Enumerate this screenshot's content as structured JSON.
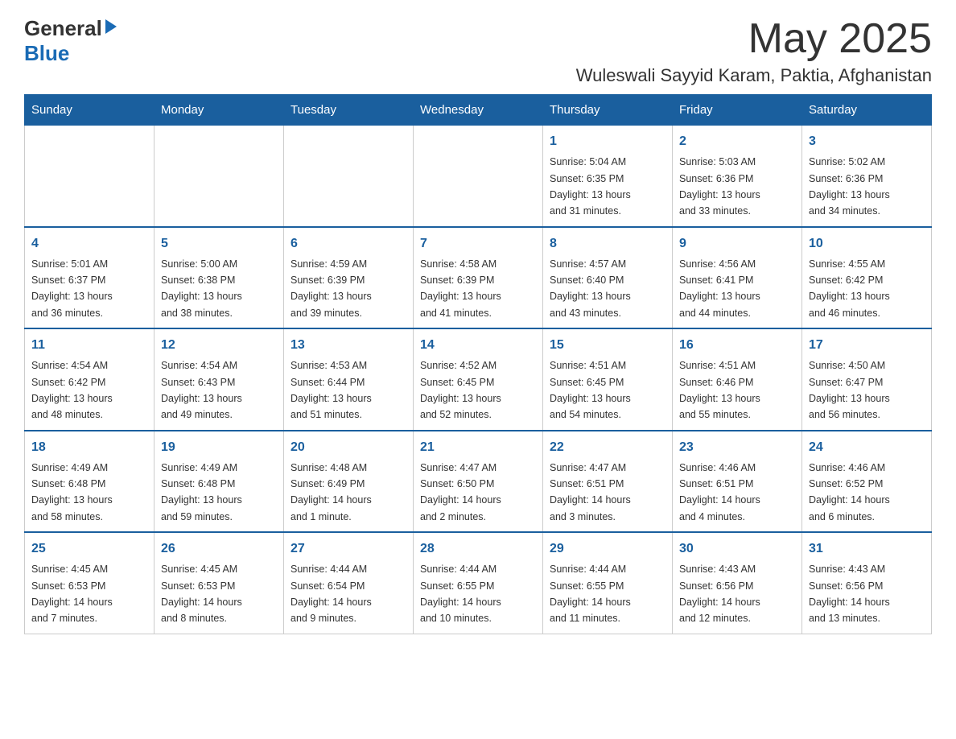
{
  "header": {
    "logo_general": "General",
    "logo_blue": "Blue",
    "month": "May 2025",
    "location": "Wuleswali Sayyid Karam, Paktia, Afghanistan"
  },
  "days_of_week": [
    "Sunday",
    "Monday",
    "Tuesday",
    "Wednesday",
    "Thursday",
    "Friday",
    "Saturday"
  ],
  "weeks": [
    [
      {
        "day": "",
        "info": ""
      },
      {
        "day": "",
        "info": ""
      },
      {
        "day": "",
        "info": ""
      },
      {
        "day": "",
        "info": ""
      },
      {
        "day": "1",
        "info": "Sunrise: 5:04 AM\nSunset: 6:35 PM\nDaylight: 13 hours\nand 31 minutes."
      },
      {
        "day": "2",
        "info": "Sunrise: 5:03 AM\nSunset: 6:36 PM\nDaylight: 13 hours\nand 33 minutes."
      },
      {
        "day": "3",
        "info": "Sunrise: 5:02 AM\nSunset: 6:36 PM\nDaylight: 13 hours\nand 34 minutes."
      }
    ],
    [
      {
        "day": "4",
        "info": "Sunrise: 5:01 AM\nSunset: 6:37 PM\nDaylight: 13 hours\nand 36 minutes."
      },
      {
        "day": "5",
        "info": "Sunrise: 5:00 AM\nSunset: 6:38 PM\nDaylight: 13 hours\nand 38 minutes."
      },
      {
        "day": "6",
        "info": "Sunrise: 4:59 AM\nSunset: 6:39 PM\nDaylight: 13 hours\nand 39 minutes."
      },
      {
        "day": "7",
        "info": "Sunrise: 4:58 AM\nSunset: 6:39 PM\nDaylight: 13 hours\nand 41 minutes."
      },
      {
        "day": "8",
        "info": "Sunrise: 4:57 AM\nSunset: 6:40 PM\nDaylight: 13 hours\nand 43 minutes."
      },
      {
        "day": "9",
        "info": "Sunrise: 4:56 AM\nSunset: 6:41 PM\nDaylight: 13 hours\nand 44 minutes."
      },
      {
        "day": "10",
        "info": "Sunrise: 4:55 AM\nSunset: 6:42 PM\nDaylight: 13 hours\nand 46 minutes."
      }
    ],
    [
      {
        "day": "11",
        "info": "Sunrise: 4:54 AM\nSunset: 6:42 PM\nDaylight: 13 hours\nand 48 minutes."
      },
      {
        "day": "12",
        "info": "Sunrise: 4:54 AM\nSunset: 6:43 PM\nDaylight: 13 hours\nand 49 minutes."
      },
      {
        "day": "13",
        "info": "Sunrise: 4:53 AM\nSunset: 6:44 PM\nDaylight: 13 hours\nand 51 minutes."
      },
      {
        "day": "14",
        "info": "Sunrise: 4:52 AM\nSunset: 6:45 PM\nDaylight: 13 hours\nand 52 minutes."
      },
      {
        "day": "15",
        "info": "Sunrise: 4:51 AM\nSunset: 6:45 PM\nDaylight: 13 hours\nand 54 minutes."
      },
      {
        "day": "16",
        "info": "Sunrise: 4:51 AM\nSunset: 6:46 PM\nDaylight: 13 hours\nand 55 minutes."
      },
      {
        "day": "17",
        "info": "Sunrise: 4:50 AM\nSunset: 6:47 PM\nDaylight: 13 hours\nand 56 minutes."
      }
    ],
    [
      {
        "day": "18",
        "info": "Sunrise: 4:49 AM\nSunset: 6:48 PM\nDaylight: 13 hours\nand 58 minutes."
      },
      {
        "day": "19",
        "info": "Sunrise: 4:49 AM\nSunset: 6:48 PM\nDaylight: 13 hours\nand 59 minutes."
      },
      {
        "day": "20",
        "info": "Sunrise: 4:48 AM\nSunset: 6:49 PM\nDaylight: 14 hours\nand 1 minute."
      },
      {
        "day": "21",
        "info": "Sunrise: 4:47 AM\nSunset: 6:50 PM\nDaylight: 14 hours\nand 2 minutes."
      },
      {
        "day": "22",
        "info": "Sunrise: 4:47 AM\nSunset: 6:51 PM\nDaylight: 14 hours\nand 3 minutes."
      },
      {
        "day": "23",
        "info": "Sunrise: 4:46 AM\nSunset: 6:51 PM\nDaylight: 14 hours\nand 4 minutes."
      },
      {
        "day": "24",
        "info": "Sunrise: 4:46 AM\nSunset: 6:52 PM\nDaylight: 14 hours\nand 6 minutes."
      }
    ],
    [
      {
        "day": "25",
        "info": "Sunrise: 4:45 AM\nSunset: 6:53 PM\nDaylight: 14 hours\nand 7 minutes."
      },
      {
        "day": "26",
        "info": "Sunrise: 4:45 AM\nSunset: 6:53 PM\nDaylight: 14 hours\nand 8 minutes."
      },
      {
        "day": "27",
        "info": "Sunrise: 4:44 AM\nSunset: 6:54 PM\nDaylight: 14 hours\nand 9 minutes."
      },
      {
        "day": "28",
        "info": "Sunrise: 4:44 AM\nSunset: 6:55 PM\nDaylight: 14 hours\nand 10 minutes."
      },
      {
        "day": "29",
        "info": "Sunrise: 4:44 AM\nSunset: 6:55 PM\nDaylight: 14 hours\nand 11 minutes."
      },
      {
        "day": "30",
        "info": "Sunrise: 4:43 AM\nSunset: 6:56 PM\nDaylight: 14 hours\nand 12 minutes."
      },
      {
        "day": "31",
        "info": "Sunrise: 4:43 AM\nSunset: 6:56 PM\nDaylight: 14 hours\nand 13 minutes."
      }
    ]
  ]
}
